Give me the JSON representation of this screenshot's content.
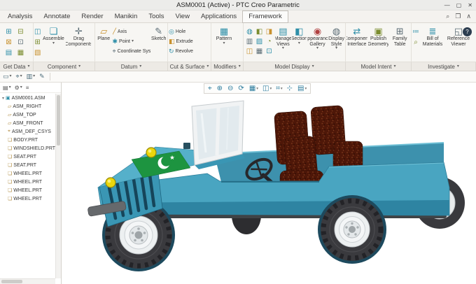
{
  "window": {
    "title": "ASM0001 (Active) - PTC Creo Parametric",
    "minimize": "—",
    "restore": "▢",
    "close": "✕"
  },
  "ui": {
    "caret": "▾"
  },
  "tabs": [
    "Analysis",
    "Annotate",
    "Render",
    "Manikin",
    "Tools",
    "View",
    "Applications",
    "Framework"
  ],
  "tab_actions": {
    "search": "⌕",
    "windows": "❐",
    "collapse": "∧",
    "help": "?"
  },
  "ribbon": {
    "get_data": {
      "label": "Get Data",
      "icons": [
        "⊞",
        "⊟",
        "⊠",
        "⊡",
        "▤",
        "▦"
      ]
    },
    "component": {
      "label": "Component",
      "assemble": "Assemble",
      "drag": "Drag Components",
      "icons": [
        "◫",
        "⊞",
        "▧"
      ]
    },
    "datum": {
      "label": "Datum",
      "plane": "Plane",
      "axis": "Axis",
      "point": "Point",
      "csys": "Coordinate System",
      "sketch": "Sketch"
    },
    "cut": {
      "label": "Cut & Surface",
      "hole": "Hole",
      "extrude": "Extrude",
      "revolve": "Revolve"
    },
    "modifiers": {
      "label": "Modifiers",
      "pattern": "Pattern"
    },
    "display": {
      "label": "Model Display",
      "manage_views": "Manage Views",
      "section": "Section",
      "appearance": "Appearance Gallery",
      "style": "Display Style",
      "icons": [
        "◍",
        "◧",
        "◨",
        "▥",
        "▨",
        "◔",
        "◫",
        "▦",
        "⊡"
      ]
    },
    "intent": {
      "label": "Model Intent",
      "interface": "Component Interface",
      "publish": "Publish Geometry",
      "family": "Family Table"
    },
    "investigate": {
      "label": "Investigate",
      "bom": "Bill of Materials",
      "ref_viewer": "Reference Viewer",
      "icons": [
        "≔",
        "⌕"
      ]
    }
  },
  "toolbar2": {
    "icons": [
      {
        "name": "selection-filter",
        "glyph": "▭",
        "caret": "▾"
      },
      {
        "name": "find",
        "glyph": "⌖",
        "caret": "▾"
      },
      {
        "name": "layers",
        "glyph": "▥",
        "caret": "▾"
      },
      {
        "name": "annotate-display",
        "glyph": "✎",
        "caret": ""
      }
    ]
  },
  "graphics_toolbar": {
    "icons": [
      {
        "name": "refit",
        "glyph": "⌖",
        "caret": ""
      },
      {
        "name": "zoom-in",
        "glyph": "⊕",
        "caret": ""
      },
      {
        "name": "zoom-out",
        "glyph": "⊖",
        "caret": ""
      },
      {
        "name": "repaint",
        "glyph": "⟳",
        "caret": ""
      },
      {
        "name": "display-style",
        "glyph": "▦",
        "caret": "▾"
      },
      {
        "name": "datum-display",
        "glyph": "◫",
        "caret": "▾"
      },
      {
        "name": "annotation-display",
        "glyph": "⌗",
        "caret": "▾"
      },
      {
        "name": "spin-center",
        "glyph": "⊹",
        "caret": ""
      },
      {
        "name": "saved-orientations",
        "glyph": "▤",
        "caret": "▾"
      }
    ]
  },
  "panel": {
    "header_icons": [
      {
        "name": "tree-columns",
        "glyph": "▤",
        "caret": "▾"
      },
      {
        "name": "tree-settings",
        "glyph": "⚙",
        "caret": "▾"
      },
      {
        "name": "show-list",
        "glyph": "≡",
        "caret": ""
      }
    ],
    "root": {
      "icon": "▣",
      "label": "ASM0001.ASM",
      "twisty": "▾"
    },
    "items": [
      {
        "icon": "▱",
        "label": "ASM_RIGHT"
      },
      {
        "icon": "▱",
        "label": "ASM_TOP"
      },
      {
        "icon": "▱",
        "label": "ASM_FRONT"
      },
      {
        "icon": "⌖",
        "label": "ASM_DEF_CSYS"
      },
      {
        "icon": "❏",
        "label": "BODY.PRT"
      },
      {
        "icon": "❏",
        "label": "WINDSHIELD.PRT"
      },
      {
        "icon": "❏",
        "label": "SEAT.PRT"
      },
      {
        "icon": "❏",
        "label": "SEAT.PRT"
      },
      {
        "icon": "❏",
        "label": "WHEEL.PRT"
      },
      {
        "icon": "❏",
        "label": "WHEEL.PRT"
      },
      {
        "icon": "❏",
        "label": "WHEEL.PRT"
      },
      {
        "icon": "❏",
        "label": "WHEEL.PRT"
      }
    ]
  },
  "scene": {
    "model": "jeep-assembly",
    "colors": {
      "body": "#49a5c1",
      "body_shadow": "#2e84a2",
      "hood": "#55b0ca",
      "grille": "#3a96b4",
      "grille_slot": "#16455a",
      "interior": "#3d91ad",
      "flag_green": "#1d9440",
      "seat_base": "#4e1708",
      "tire": "#3a3a3e",
      "hub": "#edf0f1",
      "headlight": "#ecd70c",
      "glass": "#e2eaee",
      "frame": "#f1f3f4",
      "bumper": "#66696c"
    }
  }
}
